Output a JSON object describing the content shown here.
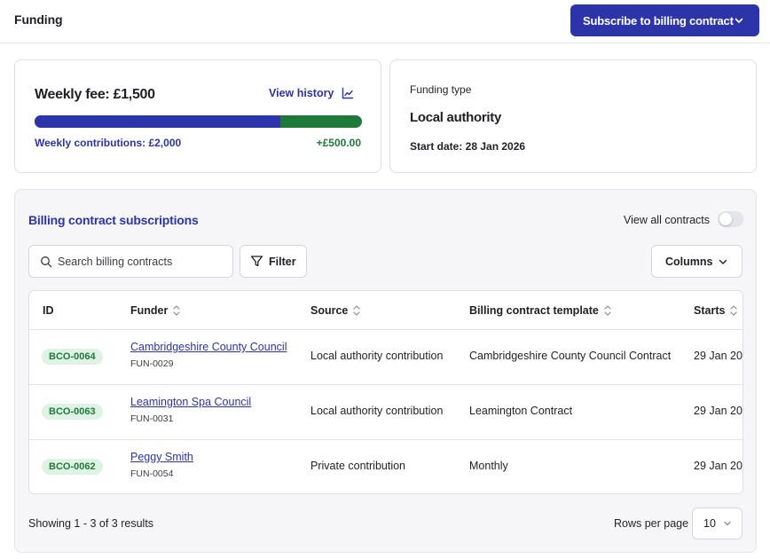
{
  "header": {
    "title": "Funding",
    "subscribe_label": "Subscribe to billing contract"
  },
  "fee_card": {
    "title": "Weekly fee: £1,500",
    "view_history_label": "View history",
    "contributions_label": "Weekly contributions: £2,000",
    "surplus": "+£500.00",
    "fee_fraction": 0.75
  },
  "type_card": {
    "label": "Funding type",
    "value": "Local authority",
    "start_date": "Start date: 28 Jan 2026"
  },
  "subscriptions": {
    "title": "Billing contract subscriptions",
    "view_all_label": "View all contracts",
    "view_all_on": false,
    "search_placeholder": "Search billing contracts",
    "filter_label": "Filter",
    "columns_label": "Columns",
    "headers": {
      "id": "ID",
      "funder": "Funder",
      "source": "Source",
      "template": "Billing contract template",
      "starts": "Starts"
    },
    "rows": [
      {
        "id": "BCO-0064",
        "funder": "Cambridgeshire County Council",
        "funder_code": "FUN-0029",
        "source": "Local authority contribution",
        "template": "Cambridgeshire County Council Contract",
        "starts": "29 Jan 20"
      },
      {
        "id": "BCO-0063",
        "funder": "Leamington Spa Council",
        "funder_code": "FUN-0031",
        "source": "Local authority contribution",
        "template": "Leamington Contract",
        "starts": "29 Jan 20"
      },
      {
        "id": "BCO-0062",
        "funder": "Peggy Smith",
        "funder_code": "FUN-0054",
        "source": "Private contribution",
        "template": "Monthly",
        "starts": "29 Jan 20"
      }
    ],
    "showing": "Showing 1 - 3 of 3 results",
    "rows_per_page_label": "Rows per page",
    "rows_per_page_value": "10"
  },
  "colors": {
    "primary": "#2b34a8",
    "success": "#1f7a3a",
    "badge_bg": "#dff3e4"
  }
}
